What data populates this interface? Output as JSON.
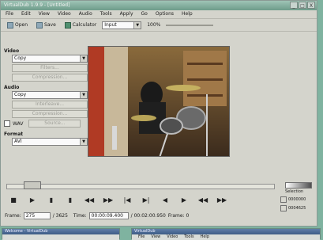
{
  "window": {
    "title": "VirtualDub 1.9.9 - [Untitled]",
    "controls": [
      "_",
      "□",
      "X"
    ]
  },
  "menu": [
    "File",
    "Edit",
    "View",
    "Video",
    "Audio",
    "Tools",
    "Apply",
    "Go",
    "Options",
    "Help"
  ],
  "toolbar": {
    "open_label": "Open",
    "save_label": "Save",
    "calculator_label": "Calculator",
    "input_select": "Input",
    "zoom_label": "100%"
  },
  "video": {
    "section": "Video",
    "mode": "Copy",
    "buttons": [
      "Filters...",
      "Compression..."
    ]
  },
  "audio": {
    "section": "Audio",
    "mode": "Copy",
    "buttons": [
      "Interleave...",
      "Compression..."
    ],
    "wav_label": "WAV",
    "wav_button": "Source..."
  },
  "format": {
    "section": "Format",
    "value": "AVI"
  },
  "transport": [
    "■",
    "▶",
    "▮",
    "▮",
    "◀◀",
    "▶▶",
    "|◀",
    "▶|",
    "◀",
    "▶",
    "◀◀",
    "▶▶"
  ],
  "status": {
    "frame_label": "Frame:",
    "frame_value": "275",
    "total": "/ 3625",
    "time_label": "Time:",
    "time_value": "00:00:09.400",
    "duration": "/ 00:02:00.950",
    "mark_label": "Frame: 0"
  },
  "selection": {
    "label": "Selection",
    "start": "0000000",
    "end": "0004625"
  },
  "taskbar": {
    "window1_title": "Welcome - VirtualDub",
    "window2_title": "VirtualDub",
    "window2_menu": [
      "File",
      "View",
      "Video",
      "Tools",
      "Help"
    ]
  }
}
